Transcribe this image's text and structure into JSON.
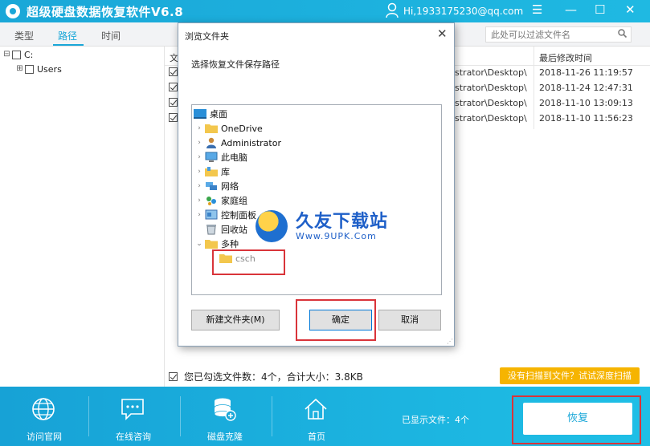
{
  "window": {
    "title": "超级硬盘数据恢复软件V6.8",
    "user_email": "Hi,1933175230@qq.com",
    "controls": [
      "☰",
      "—",
      "☐",
      "✕"
    ]
  },
  "tabs": [
    {
      "label": "类型",
      "active": false
    },
    {
      "label": "路径",
      "active": true
    },
    {
      "label": "时间",
      "active": false
    }
  ],
  "filter": {
    "placeholder": "此处可以过滤文件名"
  },
  "tree": {
    "root": {
      "label": "C:",
      "expander": "⊟"
    },
    "child": {
      "label": "Users",
      "expander": "⊞"
    }
  },
  "file_list": {
    "header_first": "文",
    "header_time": "最后修改时间",
    "rows": [
      {
        "path": "strator\\Desktop\\",
        "time": "2018-11-26 11:19:57"
      },
      {
        "path": "strator\\Desktop\\",
        "time": "2018-11-24 12:47:31"
      },
      {
        "path": "strator\\Desktop\\",
        "time": "2018-11-10 13:09:13"
      },
      {
        "path": "strator\\Desktop\\",
        "time": "2018-11-10 11:56:23"
      }
    ]
  },
  "status": {
    "selected_text": "您已勾选文件数：4个，合计大小：3.8KB",
    "deep_scan_label": "没有扫描到文件？试试深度扫描"
  },
  "bottom_nav": [
    {
      "label": "访问官网",
      "icon": "globe-icon"
    },
    {
      "label": "在线咨询",
      "icon": "chat-icon"
    },
    {
      "label": "磁盘克隆",
      "icon": "disk-clone-icon"
    },
    {
      "label": "首页",
      "icon": "home-icon"
    }
  ],
  "shown_files": "已显示文件：4个",
  "recover_label": "恢复",
  "dialog": {
    "title": "浏览文件夹",
    "prompt": "选择恢复文件保存路径",
    "folders": [
      {
        "label": "桌面",
        "level": 0,
        "arrow": "",
        "icon": "desktop-icon"
      },
      {
        "label": "OneDrive",
        "level": 1,
        "arrow": "›",
        "icon": "folder-icon"
      },
      {
        "label": "Administrator",
        "level": 1,
        "arrow": "›",
        "icon": "user-icon"
      },
      {
        "label": "此电脑",
        "level": 1,
        "arrow": "›",
        "icon": "computer-icon"
      },
      {
        "label": "库",
        "level": 1,
        "arrow": "›",
        "icon": "library-icon"
      },
      {
        "label": "网络",
        "level": 1,
        "arrow": "›",
        "icon": "network-icon"
      },
      {
        "label": "家庭组",
        "level": 1,
        "arrow": "›",
        "icon": "homegroup-icon"
      },
      {
        "label": "控制面板",
        "level": 1,
        "arrow": "›",
        "icon": "control-panel-icon"
      },
      {
        "label": "回收站",
        "level": 1,
        "arrow": "",
        "icon": "recycle-bin-icon"
      },
      {
        "label": "多种",
        "level": 1,
        "arrow": "⌄",
        "icon": "folder-icon"
      },
      {
        "label": "csch",
        "level": 2,
        "arrow": "",
        "icon": "folder-icon"
      }
    ],
    "new_folder_label": "新建文件夹(M)",
    "ok_label": "确定",
    "cancel_label": "取消"
  },
  "watermark": {
    "title": "久友下载站",
    "url": "Www.9UPK.Com"
  },
  "colors": {
    "accent": "#1aa7d8",
    "deep_scan": "#f6b400",
    "annotation_red": "#d9343a"
  }
}
